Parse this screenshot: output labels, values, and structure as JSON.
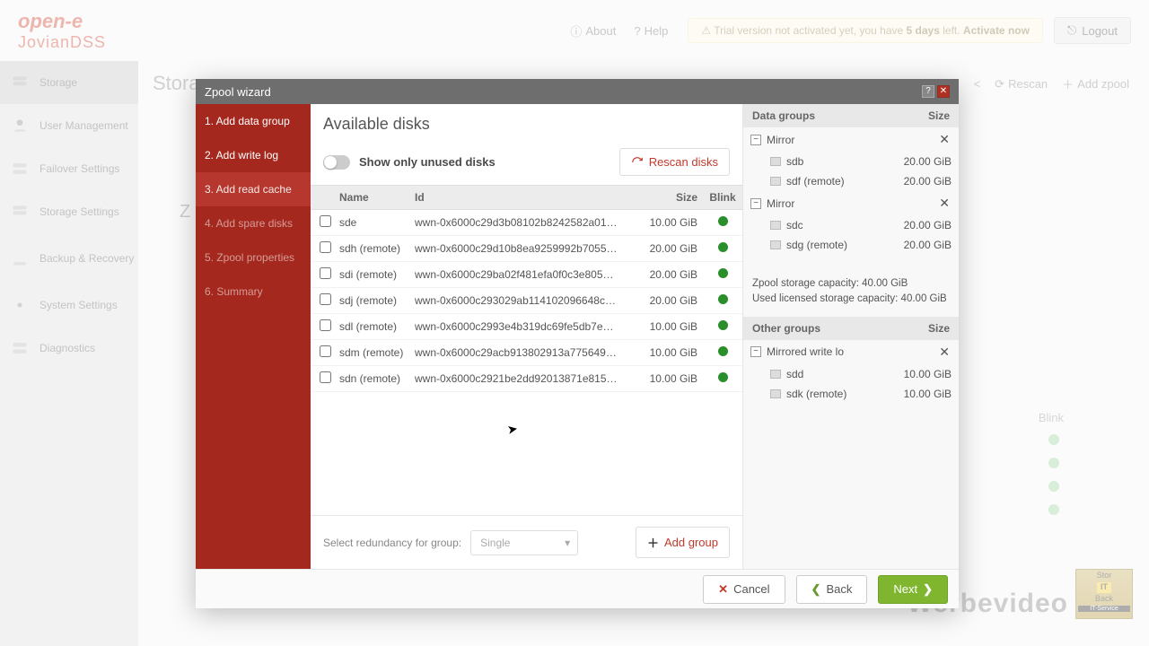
{
  "top": {
    "brand1": "open-e",
    "brand2": "JovianDSS",
    "about": "About",
    "help": "Help",
    "warn_prefix": "Trial version not activated yet, you have ",
    "warn_days": "5 days",
    "warn_suffix": " left. ",
    "warn_activate": "Activate now",
    "logout": "Logout",
    "rescan": "Rescan",
    "addzpool": "Add zpool"
  },
  "sidebar": {
    "items": [
      "Storage",
      "User Management",
      "Failover Settings",
      "Storage Settings",
      "Backup & Recovery",
      "System Settings",
      "Diagnostics"
    ]
  },
  "page": {
    "title": "Storage",
    "sub": "Z"
  },
  "bgblink_head": "Blink",
  "modal": {
    "title": "Zpool wizard",
    "steps": [
      "1. Add data group",
      "2. Add write log",
      "3. Add read cache",
      "4. Add spare disks",
      "5. Zpool properties",
      "6. Summary"
    ],
    "current_step_index": 2,
    "avail_title": "Available disks",
    "toggle_label": "Show only unused disks",
    "rescan": "Rescan disks",
    "columns": {
      "name": "Name",
      "id": "Id",
      "size": "Size",
      "blink": "Blink"
    },
    "disks": [
      {
        "name": "sde",
        "id": "wwn-0x6000c29d3b08102b8242582a01…",
        "size": "10.00 GiB"
      },
      {
        "name": "sdh (remote)",
        "id": "wwn-0x6000c29d10b8ea9259992b7055…",
        "size": "20.00 GiB"
      },
      {
        "name": "sdi (remote)",
        "id": "wwn-0x6000c29ba02f481efa0f0c3e805…",
        "size": "20.00 GiB"
      },
      {
        "name": "sdj (remote)",
        "id": "wwn-0x6000c293029ab114102096648c…",
        "size": "20.00 GiB"
      },
      {
        "name": "sdl (remote)",
        "id": "wwn-0x6000c2993e4b319dc69fe5db7e…",
        "size": "10.00 GiB"
      },
      {
        "name": "sdm (remote)",
        "id": "wwn-0x6000c29acb913802913a775649…",
        "size": "10.00 GiB"
      },
      {
        "name": "sdn (remote)",
        "id": "wwn-0x6000c2921be2dd92013871e815…",
        "size": "10.00 GiB"
      }
    ],
    "redundancy_label": "Select redundancy for group:",
    "redundancy_value": "Single",
    "addgroup": "Add group",
    "right": {
      "datagroups_head": "Data groups",
      "size_head": "Size",
      "mirrors": [
        {
          "name": "Mirror",
          "disks": [
            {
              "n": "sdb",
              "s": "20.00 GiB"
            },
            {
              "n": "sdf (remote)",
              "s": "20.00 GiB"
            }
          ]
        },
        {
          "name": "Mirror",
          "disks": [
            {
              "n": "sdc",
              "s": "20.00 GiB"
            },
            {
              "n": "sdg (remote)",
              "s": "20.00 GiB"
            }
          ]
        }
      ],
      "cap1": "Zpool storage capacity: 40.00 GiB",
      "cap2": "Used licensed storage capacity: 40.00 GiB",
      "othergroups_head": "Other groups",
      "other": [
        {
          "name": "Mirrored write lo",
          "disks": [
            {
              "n": "sdd",
              "s": "10.00 GiB"
            },
            {
              "n": "sdk (remote)",
              "s": "10.00 GiB"
            }
          ]
        }
      ]
    },
    "buttons": {
      "cancel": "Cancel",
      "back": "Back",
      "next": "Next"
    }
  },
  "wm": "Werbevideo",
  "wm2": {
    "l1": "Stor",
    "l2": "IT",
    "l3": "Back",
    "l4": "IT-Service"
  }
}
